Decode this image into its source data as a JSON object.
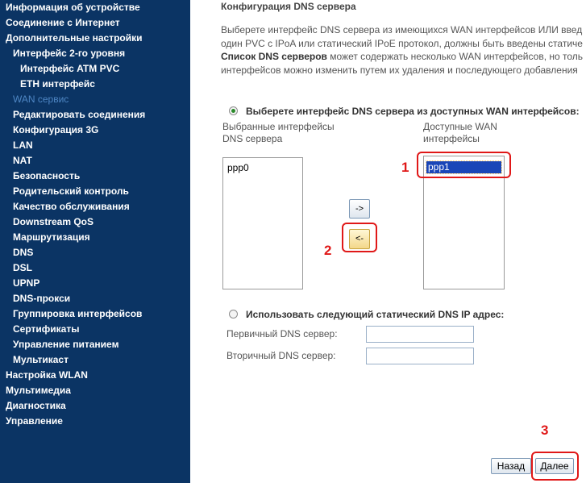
{
  "sidebar": {
    "items": [
      {
        "label": "Информация об устройстве"
      },
      {
        "label": "Соединение с Интернет"
      },
      {
        "label": "Дополнительные настройки"
      },
      {
        "label": "Интерфейс 2-го уровня"
      },
      {
        "label": "Интерфейс ATM PVC"
      },
      {
        "label": "ETH интерфейс"
      },
      {
        "label": "WAN сервис"
      },
      {
        "label": "Редактировать соединения"
      },
      {
        "label": "Конфигурация 3G"
      },
      {
        "label": "LAN"
      },
      {
        "label": "NAT"
      },
      {
        "label": "Безопасность"
      },
      {
        "label": "Родительский контроль"
      },
      {
        "label": "Качество обслуживания"
      },
      {
        "label": "Downstream QoS"
      },
      {
        "label": "Маршрутизация"
      },
      {
        "label": "DNS"
      },
      {
        "label": "DSL"
      },
      {
        "label": "UPNP"
      },
      {
        "label": "DNS-прокси"
      },
      {
        "label": "Группировка интерфейсов"
      },
      {
        "label": "Сертификаты"
      },
      {
        "label": "Управление питанием"
      },
      {
        "label": "Мультикаст"
      },
      {
        "label": "Настройка WLAN"
      },
      {
        "label": "Мультимедиа"
      },
      {
        "label": "Диагностика"
      },
      {
        "label": "Управление"
      }
    ],
    "active_item": "WAN сервис"
  },
  "main": {
    "title": "Конфигурация DNS сервера",
    "desc_line1": "Выберете интерфейс DNS сервера из имеющихся WAN интерфейсов ИЛИ введ",
    "desc_line2": "один PVC с IPoA или статический IPoE протокол, должны быть введены статиче",
    "desc_line3_bold": "Список DNS серверов",
    "desc_line3_rest": " может содержать несколько WAN интерфейсов, но толь",
    "desc_line4": "интерфейсов можно изменить путем их удаления и последующего добавления",
    "option_interface_label": "Выберете интерфейс DNS сервера из доступных WAN интерфейсов:",
    "selected_label_1": "Выбранные интерфейсы",
    "selected_label_2": "DNS сервера",
    "available_label_1": "Доступные WAN",
    "available_label_2": "интерфейсы",
    "selected_list": [
      "ppp0"
    ],
    "available_list": [
      "ppp1"
    ],
    "move_right_label": "->",
    "move_left_label": "<-",
    "option_static_label": "Использовать следующий статический DNS IP адрес:",
    "primary_dns_label": "Первичный DNS сервер:",
    "secondary_dns_label": "Вторичный DNS сервер:",
    "primary_dns_value": "",
    "secondary_dns_value": "",
    "back_label": "Назад",
    "next_label": "Далее"
  },
  "annotations": {
    "n1": "1",
    "n2": "2",
    "n3": "3",
    "color": "#e01818"
  },
  "colors": {
    "sidebar_bg": "#0b3464",
    "active_link": "#4e86c4"
  }
}
